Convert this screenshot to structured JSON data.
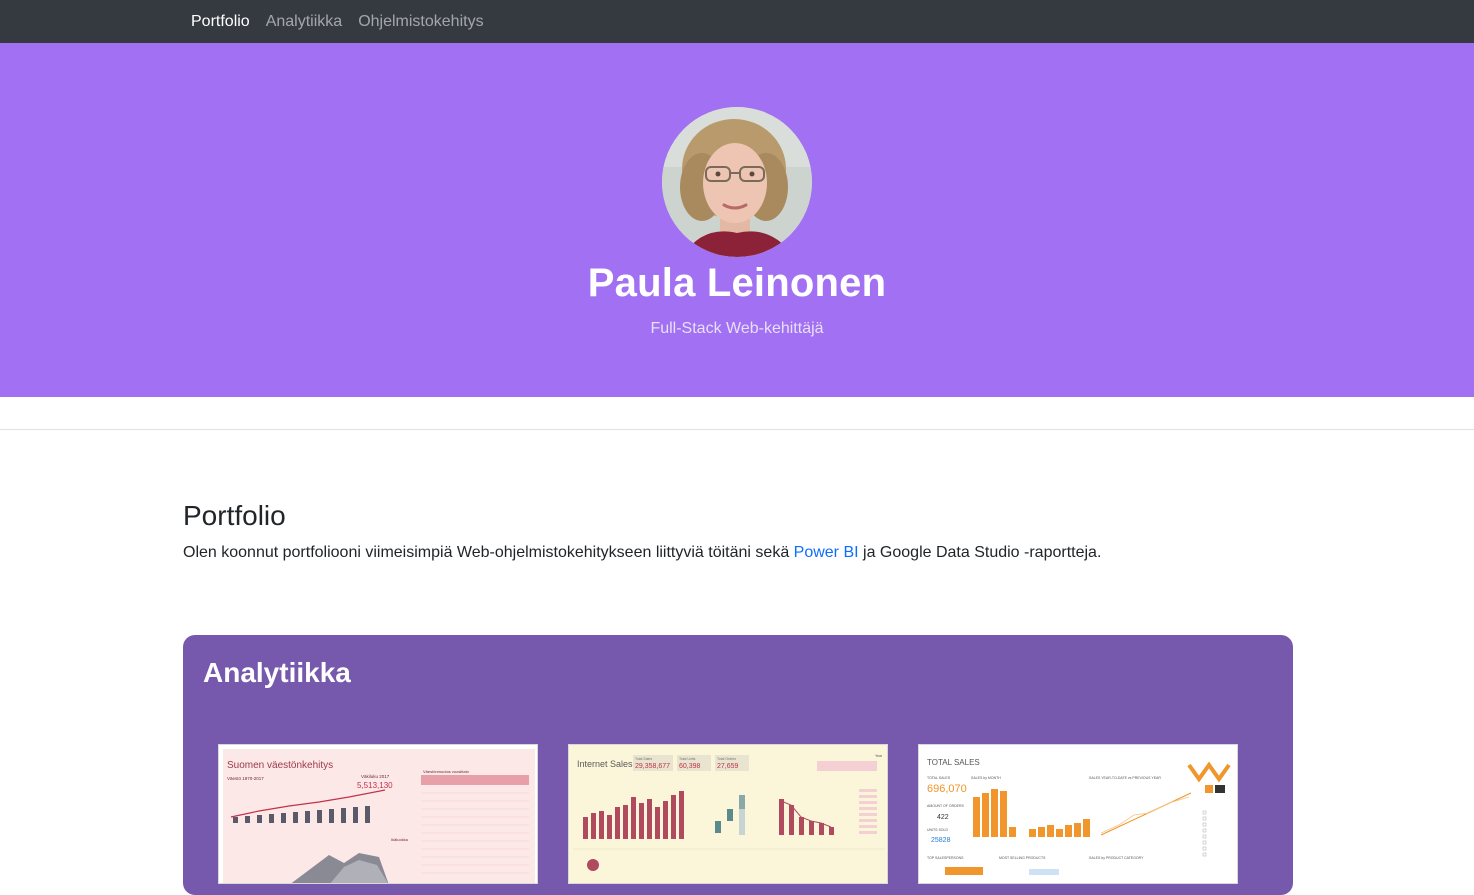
{
  "nav": {
    "items": [
      "Portfolio",
      "Analytiikka",
      "Ohjelmistokehitys"
    ]
  },
  "hero": {
    "name": "Paula Leinonen",
    "subtitle": "Full-Stack Web-kehittäjä"
  },
  "portfolio": {
    "title": "Portfolio",
    "text_before": "Olen koonnut portfoliooni viimeisimpiä Web-ohjelmistokehitykseen liittyviä töitäni sekä ",
    "link_text": "Power BI",
    "text_after": " ja Google Data Studio -raportteja."
  },
  "analytics": {
    "title": "Analytiikka",
    "reports": [
      {
        "title": "Suomen väestönkehitys",
        "subtitle": "Väestö 1970-2017",
        "kpi_label": "Väkiluku 2017",
        "kpi_value": "5,513,130",
        "table_header": "Väestönmuutos vuosittain",
        "side_label": "Ikäluokka"
      },
      {
        "title": "Internet Sales",
        "kpis": [
          {
            "label": "Total Sales",
            "value": "29,358,677"
          },
          {
            "label": "Total Units",
            "value": "60,398"
          },
          {
            "label": "Total Orders",
            "value": "27,659"
          }
        ],
        "filter_label": "Year"
      },
      {
        "title": "TOTAL SALES",
        "kpis": [
          {
            "label": "TOTAL SALES",
            "value": "696,070"
          },
          {
            "label": "AMOUNT OF ORDERS",
            "value": "422"
          },
          {
            "label": "UNITS SOLD",
            "value": "25828"
          }
        ],
        "chart1": "SALES by MONTH",
        "chart2": "SALES YEAR-TO-DATE vs PREVIOUS YEAR",
        "chart3": "TOP SALESPERSONS",
        "chart4": "MOST SELLING PRODUCTS",
        "chart5": "SALES by PRODUCT CATEGORY"
      }
    ]
  }
}
